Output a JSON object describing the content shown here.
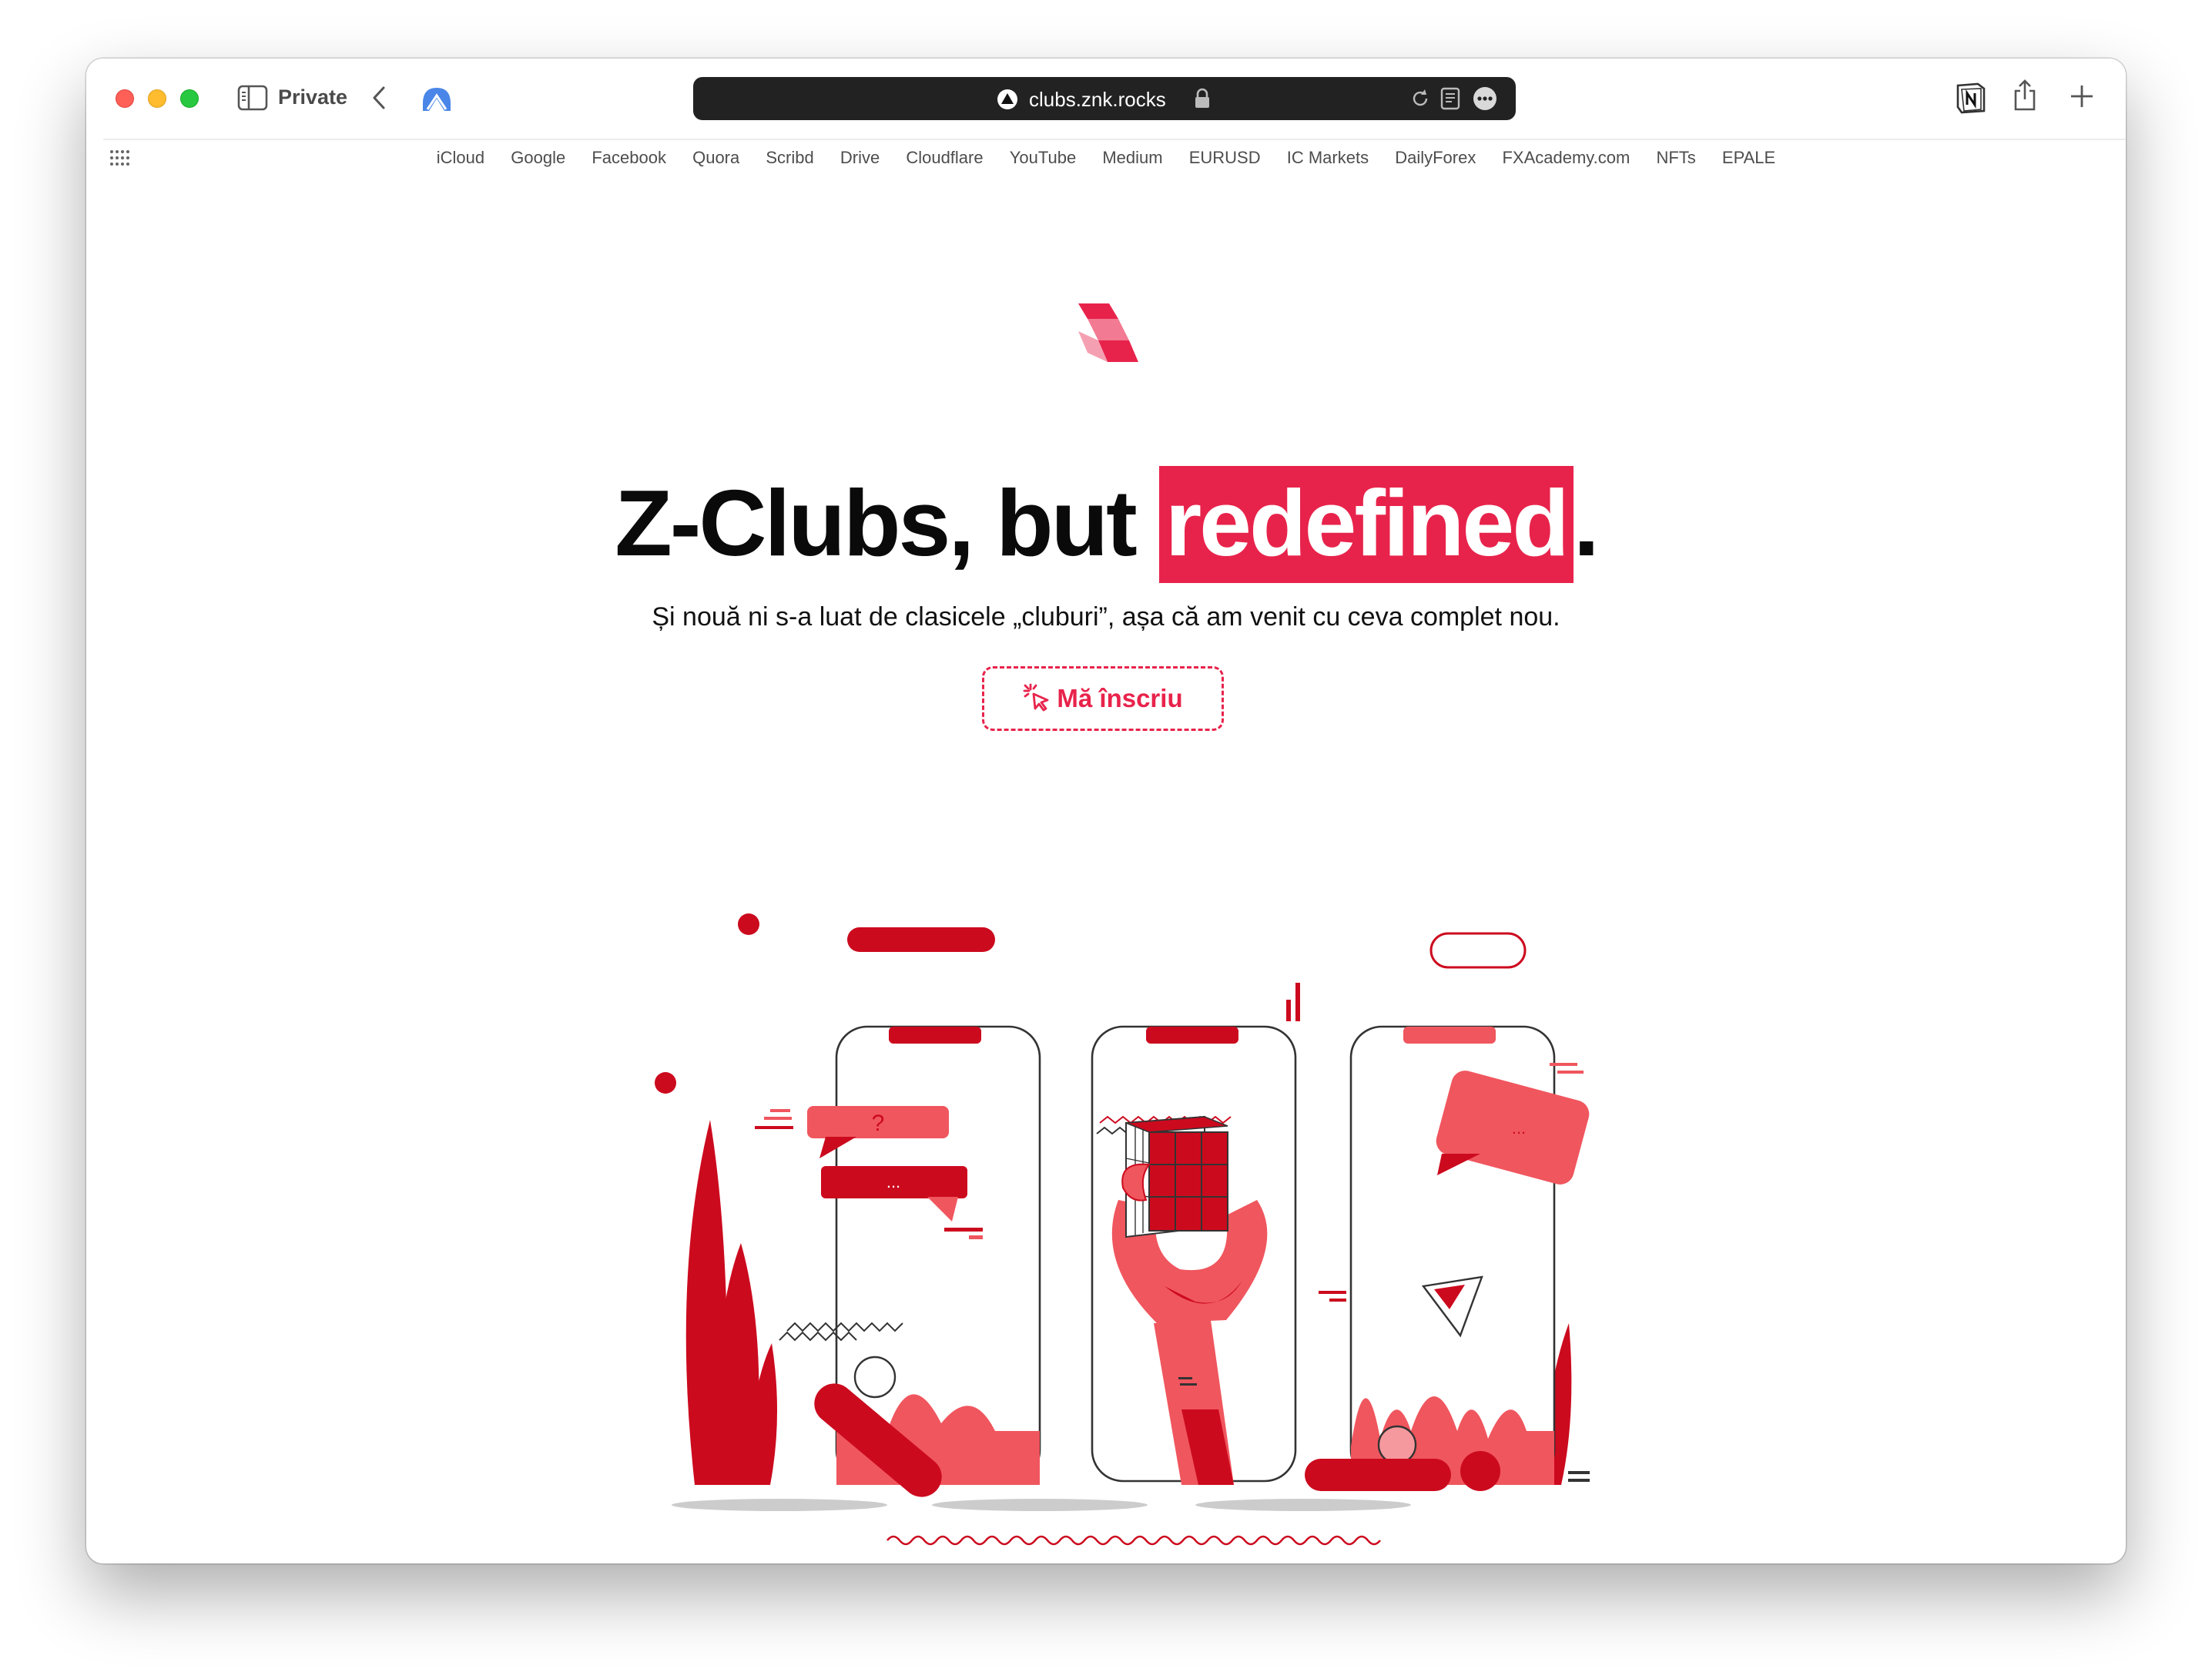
{
  "browser": {
    "mode_label": "Private",
    "url": "clubs.znk.rocks",
    "bookmarks": [
      "iCloud",
      "Google",
      "Facebook",
      "Quora",
      "Scribd",
      "Drive",
      "Cloudflare",
      "YouTube",
      "Medium",
      "EURUSD",
      "IC Markets",
      "DailyForex",
      "FXAcademy.com",
      "NFTs",
      "EPALE"
    ]
  },
  "hero": {
    "title_before": "Z-Clubs, but ",
    "title_highlight": "redefined",
    "title_after": ".",
    "subtitle": "Și nouă ni s-a luat de clasicele „cluburi”, așa că am venit cu ceva complet nou.",
    "cta_label": "Mă înscriu"
  },
  "illustration": {
    "question_mark": "?",
    "ellipsis": "..."
  },
  "colors": {
    "accent": "#e8234b",
    "dark_red": "#cc0a1e",
    "light_red": "#f0565e",
    "url_bar": "#222222"
  },
  "icons": [
    "sidebar-icon",
    "chevron-left-icon",
    "extension-icon",
    "site-icon",
    "lock-icon",
    "reload-icon",
    "reader-icon",
    "more-icon",
    "notion-icon",
    "share-icon",
    "plus-icon",
    "grid-icon",
    "z-logo-icon",
    "cursor-click-icon"
  ]
}
